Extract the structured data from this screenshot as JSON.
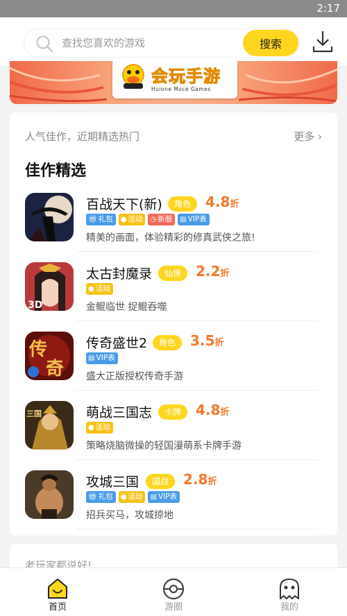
{
  "status_bar": {
    "time": "2:17"
  },
  "search": {
    "placeholder": "查找您喜欢的游戏",
    "button_label": "搜索"
  },
  "banner": {
    "logo_title": "会玩手游",
    "logo_subtitle": "Huione Moce Games"
  },
  "section": {
    "subtitle": "人气佳作，近期精选热门",
    "more_label": "更多 ›",
    "title": "佳作精选"
  },
  "games": [
    {
      "name": "百战天下(新)",
      "tag": "角色",
      "discount": "4.8",
      "discount_unit": "折",
      "labels": [
        {
          "text": "礼包",
          "color": "#4a9be8"
        },
        {
          "text": "活动",
          "color": "#f7c31c"
        },
        {
          "text": "新服",
          "color": "#f26a5a"
        },
        {
          "text": "VIP表",
          "color": "#4a9be8"
        }
      ],
      "desc": "精美的画面，体验精彩的修真武侠之旅!"
    },
    {
      "name": "太古封魔录",
      "tag": "仙侠",
      "discount": "2.2",
      "discount_unit": "折",
      "labels": [
        {
          "text": "活动",
          "color": "#f7c31c"
        }
      ],
      "desc": "金鲲临世 捉鲲吞噬"
    },
    {
      "name": "传奇盛世2",
      "tag": "角色",
      "discount": "3.5",
      "discount_unit": "折",
      "labels": [
        {
          "text": "VIP表",
          "color": "#4a9be8"
        }
      ],
      "desc": "盛大正版授权传奇手游"
    },
    {
      "name": "萌战三国志",
      "tag": "卡牌",
      "discount": "4.8",
      "discount_unit": "折",
      "labels": [
        {
          "text": "活动",
          "color": "#f7c31c"
        }
      ],
      "desc": "策略烧脑微操的轻国漫萌系卡牌手游"
    },
    {
      "name": "攻城三国",
      "tag": "国战",
      "discount": "2.8",
      "discount_unit": "折",
      "labels": [
        {
          "text": "礼包",
          "color": "#4a9be8"
        },
        {
          "text": "活动",
          "color": "#f7c31c"
        },
        {
          "text": "VIP表",
          "color": "#4a9be8"
        }
      ],
      "desc": "招兵买马，攻城掠地"
    }
  ],
  "next_section": {
    "text": "老玩家都说好!"
  },
  "tabbar": {
    "items": [
      {
        "label": "首页",
        "icon": "home-icon",
        "active": true
      },
      {
        "label": "游圈",
        "icon": "circle-icon",
        "active": false
      },
      {
        "label": "我的",
        "icon": "ghost-icon",
        "active": false
      }
    ]
  },
  "colors": {
    "accent": "#ffd61f",
    "discount": "#f4772a",
    "label_blue": "#4a9be8",
    "label_yellow": "#f7c31c",
    "label_red": "#f26a5a"
  }
}
